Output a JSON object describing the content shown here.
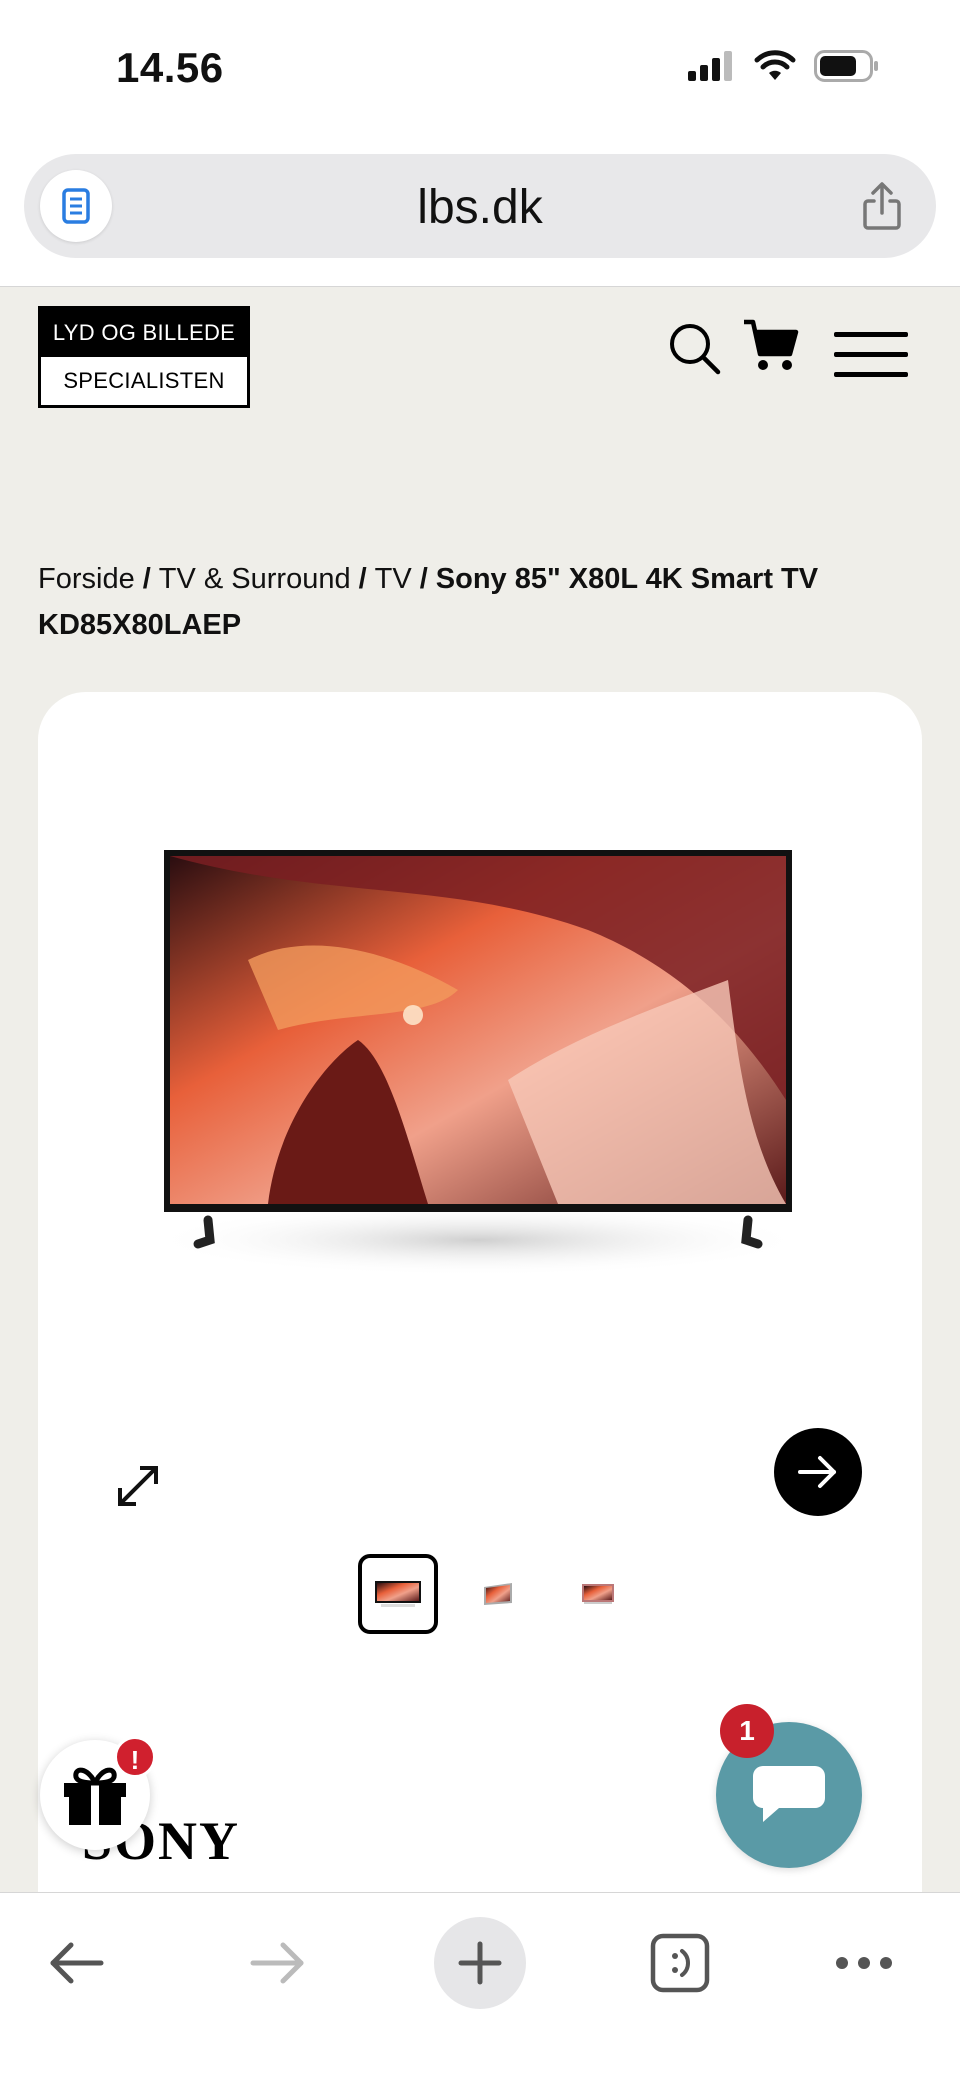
{
  "status_bar": {
    "time": "14.56"
  },
  "browser": {
    "url": "lbs.dk"
  },
  "site": {
    "logo_top": "LYD OG BILLEDE",
    "logo_bottom": "SPECIALISTEN"
  },
  "breadcrumb": {
    "items": [
      "Forside",
      "TV & Surround",
      "TV"
    ],
    "separator": "/",
    "current": "Sony 85\" X80L 4K Smart TV KD85X80LAEP"
  },
  "product": {
    "brand": "SONY",
    "thumbnail_count": 3,
    "active_thumbnail": 1
  },
  "floating": {
    "gift_badge": "!",
    "chat_badge": "1"
  },
  "icons": {
    "reader": "reader-icon",
    "share": "share-icon",
    "search": "search-icon",
    "cart": "cart-icon",
    "menu": "hamburger-menu-icon",
    "expand": "expand-icon",
    "next": "arrow-right-icon",
    "gift": "gift-icon",
    "chat": "chat-bubble-icon",
    "back": "back-arrow-icon",
    "forward": "forward-arrow-icon",
    "new_tab": "plus-icon",
    "tabs": "tabs-icon",
    "more": "more-dots-icon"
  },
  "colors": {
    "page_background": "#efeee9",
    "chat_button": "#5a9aa6",
    "badge_red": "#d0202e"
  }
}
